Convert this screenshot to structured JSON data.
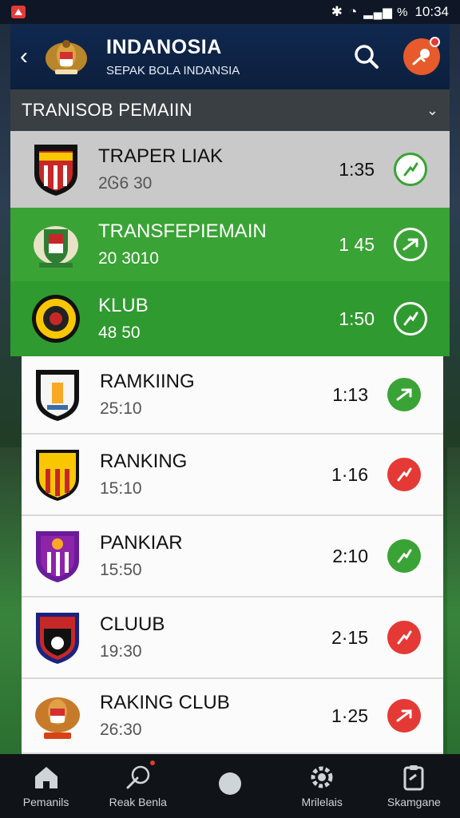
{
  "status_bar": {
    "time": "10:34",
    "signal": "▂▄▆ %"
  },
  "header": {
    "title": "INDANOSIA",
    "subtitle": "SEPAK BOLA INDANSIA"
  },
  "section": {
    "title": "TRANISOB PEMAIIN"
  },
  "rows": [
    {
      "name": "TRAPER LIAK",
      "sub": "2Ꮆ6 30",
      "time": "1:35",
      "style": "gray",
      "status": "ok",
      "logo_color": "#c62828"
    },
    {
      "name": "TRANSFEPIEMAIN",
      "sub": "20 3010",
      "time": "1 45",
      "style": "green",
      "status": "ok",
      "logo_color": "#2e7d32"
    },
    {
      "name": "KLUB",
      "sub": "48 50",
      "time": "1:50",
      "style": "green",
      "status": "ok",
      "logo_color": "#f9a825"
    },
    {
      "name": "RAMKIING",
      "sub": "25:10",
      "time": "1:13",
      "style": "white",
      "status": "ok",
      "logo_color": "#111111"
    },
    {
      "name": "RANKING",
      "sub": "15:10",
      "time": "1·16",
      "style": "white",
      "status": "bad",
      "logo_color": "#f9c700"
    },
    {
      "name": "PANKIAR",
      "sub": "15:50",
      "time": "2:10",
      "style": "white",
      "status": "ok",
      "logo_color": "#7b1fa2"
    },
    {
      "name": "CLUUB",
      "sub": "19:30",
      "time": "2·15",
      "style": "white",
      "status": "bad",
      "logo_color": "#1a237e"
    },
    {
      "name": "RAKING CLUB",
      "sub": "26:30",
      "time": "1·25",
      "style": "white",
      "status": "bad",
      "logo_color": "#d84315"
    }
  ],
  "nav": [
    {
      "label": "Pemanils",
      "icon": "home-icon"
    },
    {
      "label": "Reak Benla",
      "icon": "ball-kick-icon"
    },
    {
      "label": "",
      "icon": "ball-icon"
    },
    {
      "label": "Mrilelais",
      "icon": "gear-icon"
    },
    {
      "label": "Skamgane",
      "icon": "clipboard-icon"
    }
  ],
  "colors": {
    "accent_green": "#3aa335",
    "alert_red": "#e53935",
    "header_navy": "#0c1f3d"
  }
}
